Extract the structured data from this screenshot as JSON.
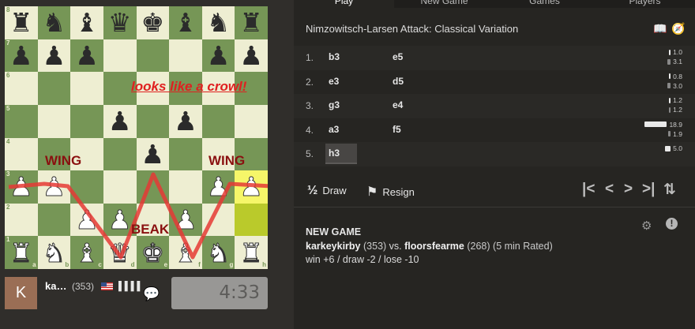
{
  "board": {
    "ranks": [
      "8",
      "7",
      "6",
      "5",
      "4",
      "3",
      "2",
      "1"
    ],
    "files": [
      "a",
      "b",
      "c",
      "d",
      "e",
      "f",
      "g",
      "h"
    ],
    "position": [
      [
        "r",
        "n",
        "b",
        "q",
        "k",
        "b",
        "n",
        "r"
      ],
      [
        "p",
        "p",
        "p",
        "",
        "",
        "",
        "p",
        "p"
      ],
      [
        "",
        "",
        "",
        "",
        "",
        "",
        "",
        ""
      ],
      [
        "",
        "",
        "",
        "p",
        "",
        "p",
        "",
        ""
      ],
      [
        "",
        "",
        "",
        "",
        "p",
        "",
        "",
        ""
      ],
      [
        "P",
        "P",
        "",
        "",
        "",
        "",
        "P",
        "P"
      ],
      [
        "",
        "",
        "P",
        "P",
        "",
        "P",
        "",
        ""
      ],
      [
        "R",
        "N",
        "B",
        "Q",
        "K",
        "B",
        "N",
        "R"
      ]
    ],
    "highlight": [
      [
        5,
        7
      ],
      [
        6,
        7
      ]
    ],
    "annotations": {
      "crowl": "looks like a crowl!",
      "wing_left": "WING",
      "wing_right": "WING",
      "beak": "BEAK"
    },
    "line_color": "#e53935"
  },
  "player": {
    "avatar_letter": "K",
    "name": "ka…",
    "rating": "(353)",
    "signal": "▌▌▌▌",
    "clock": "4:33"
  },
  "tabs": [
    "Play",
    "New Game",
    "Games",
    "Players"
  ],
  "opening": "Nimzowitsch-Larsen Attack: Classical Variation",
  "moves": [
    {
      "no": "1.",
      "white": "b3",
      "black": "e5",
      "t1": "1.0",
      "t2": "3.1",
      "w1": 0.05,
      "w2": 0.16
    },
    {
      "no": "2.",
      "white": "e3",
      "black": "d5",
      "t1": "0.8",
      "t2": "3.0",
      "w1": 0.04,
      "w2": 0.16
    },
    {
      "no": "3.",
      "white": "g3",
      "black": "e4",
      "t1": "1.2",
      "t2": "1.2",
      "w1": 0.06,
      "w2": 0.06
    },
    {
      "no": "4.",
      "white": "a3",
      "black": "f5",
      "t1": "18.9",
      "t2": "1.9",
      "w1": 1.0,
      "w2": 0.1
    },
    {
      "no": "5.",
      "white": "h3",
      "black": "",
      "t1": "5.0",
      "t2": "",
      "w1": 0.26,
      "w2": 0
    }
  ],
  "controls": {
    "draw_icon": "½",
    "draw": "Draw",
    "resign": "Resign"
  },
  "status": {
    "title": "NEW GAME",
    "white": "karkeykirby",
    "white_rating": "(353)",
    "vs": "vs.",
    "black": "floorsfearme",
    "black_rating": "(268)",
    "mode": "(5 min Rated)",
    "result_line": "win +6 / draw -2 / lose -10"
  }
}
